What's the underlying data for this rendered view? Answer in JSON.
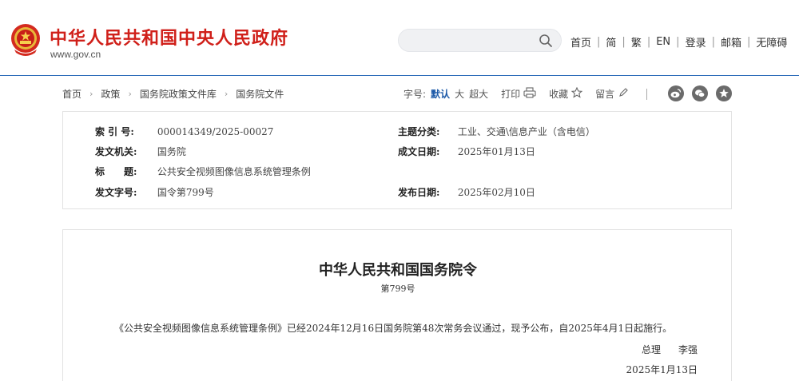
{
  "header": {
    "site_name": "中华人民共和国中央人民政府",
    "site_url": "www.gov.cn",
    "search_placeholder": "",
    "nav": [
      "首页",
      "简",
      "繁",
      "EN",
      "登录",
      "邮箱",
      "无障碍"
    ]
  },
  "breadcrumb": [
    "首页",
    "政策",
    "国务院政策文件库",
    "国务院文件"
  ],
  "tools": {
    "font_size_label": "字号:",
    "font_default": "默认",
    "font_large": "大",
    "font_xlarge": "超大",
    "print": "打印",
    "favorite": "收藏",
    "comment": "留言"
  },
  "info": {
    "index_label": "索 引 号:",
    "index_value": "000014349/2025-00027",
    "topic_label": "主题分类:",
    "topic_value": "工业、交通\\信息产业（含电信）",
    "issuer_label": "发文机关:",
    "issuer_value": "国务院",
    "written_date_label": "成文日期:",
    "written_date_value": "2025年01月13日",
    "title_label": "标　　题:",
    "title_value": "公共安全视频图像信息系统管理条例",
    "doc_no_label": "发文字号:",
    "doc_no_value": "国令第799号",
    "publish_date_label": "发布日期:",
    "publish_date_value": "2025年02月10日"
  },
  "document": {
    "title": "中华人民共和国国务院令",
    "number": "第799号",
    "body": "《公共安全视频图像信息系统管理条例》已经2024年12月16日国务院第48次常务会议通过，现予公布，自2025年4月1日起施行。",
    "signer_title": "总理",
    "signer_name": "李强",
    "date": "2025年1月13日"
  },
  "colors": {
    "brand_red": "#d0201a",
    "link_blue": "#1d5aa8",
    "header_line": "#2a6bb8"
  }
}
